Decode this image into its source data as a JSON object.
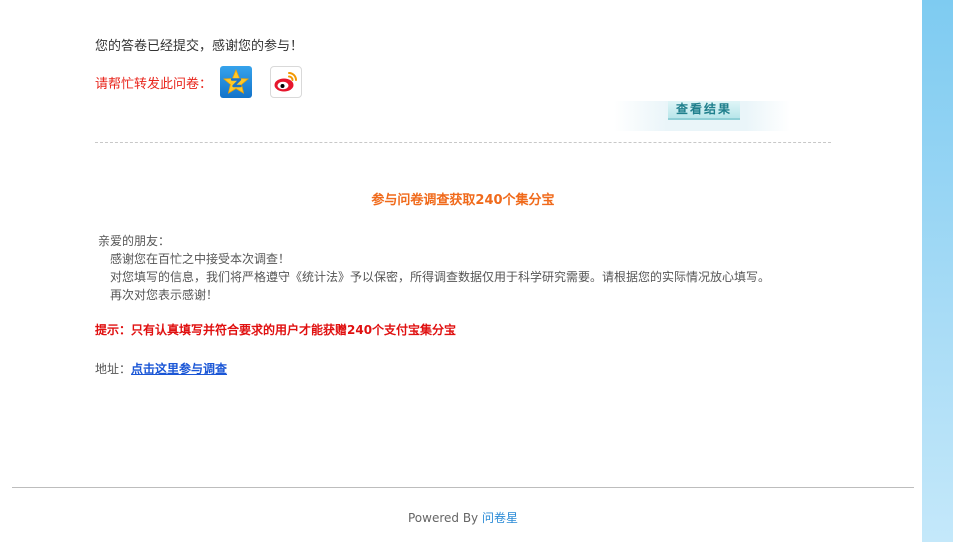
{
  "message": {
    "submitted": "您的答卷已经提交，感谢您的参与！"
  },
  "share": {
    "label": "请帮忙转发此问卷：",
    "icons": [
      "qzone-icon",
      "weibo-icon"
    ]
  },
  "result_button": {
    "label": "查看结果"
  },
  "promo": {
    "title": "参与问卷调查获取240个集分宝",
    "greeting": "亲爱的朋友：",
    "line1": "感谢您在百忙之中接受本次调查！",
    "line2": "对您填写的信息，我们将严格遵守《统计法》予以保密，所得调查数据仅用于科学研究需要。请根据您的实际情况放心填写。",
    "line3": "再次对您表示感谢！",
    "tip": "提示：只有认真填写并符合要求的用户才能获赠240个支付宝集分宝",
    "address_label": "地址：",
    "address_link": "点击这里参与调查"
  },
  "footer": {
    "powered_by": "Powered By",
    "brand": "问卷星"
  },
  "colors": {
    "share_label": "#e8241b",
    "promo_title": "#f06a1b",
    "tip": "#e01010",
    "link": "#1a56d6",
    "brand_link": "#2a8ad6",
    "background": "#7ecbf1"
  }
}
